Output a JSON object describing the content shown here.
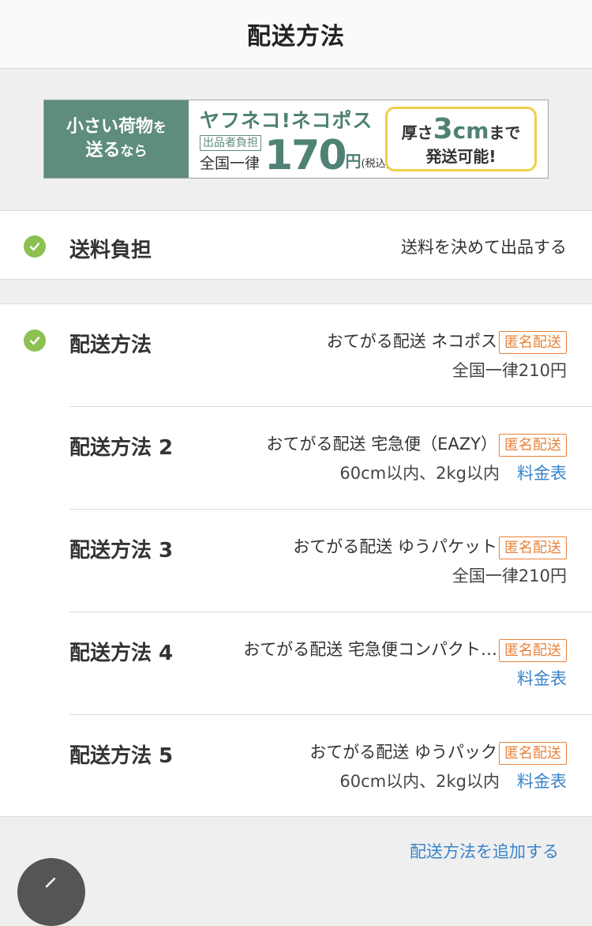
{
  "header": {
    "title": "配送方法"
  },
  "banner": {
    "left_line1": "小さい荷物",
    "left_line1_suffix": "を",
    "left_line2": "送る",
    "left_line2_suffix": "なら",
    "brand": "ヤフネコ!ネコポス",
    "tag": "出品者負担",
    "uniform": "全国一律",
    "price": "170",
    "yen": "円",
    "tax": "(税込)",
    "right_prefix": "厚さ",
    "right_number": "3",
    "right_unit": "cm",
    "right_suffix": "まで",
    "right_line2": "発送可能!"
  },
  "shipping_fee": {
    "label": "送料負担",
    "value": "送料を決めて出品する"
  },
  "methods": [
    {
      "label": "配送方法",
      "service": "おてがる配送 ネコポス",
      "badge": "匿名配送",
      "sub": "全国一律210円",
      "link": ""
    },
    {
      "label": "配送方法 2",
      "service": "おてがる配送 宅急便（EAZY）",
      "badge": "匿名配送",
      "sub": "60cm以内、2kg以内",
      "link": "料金表"
    },
    {
      "label": "配送方法 3",
      "service": "おてがる配送 ゆうパケット",
      "badge": "匿名配送",
      "sub": "全国一律210円",
      "link": ""
    },
    {
      "label": "配送方法 4",
      "service": "おてがる配送 宅急便コンパクト…",
      "badge": "匿名配送",
      "sub": "",
      "link": "料金表"
    },
    {
      "label": "配送方法 5",
      "service": "おてがる配送 ゆうパック",
      "badge": "匿名配送",
      "sub": "60cm以内、2kg以内",
      "link": "料金表"
    }
  ],
  "add_method": "配送方法を追加する",
  "colors": {
    "check": "#8cc152",
    "badge": "#e8823a",
    "link": "#3a84c9",
    "banner_green": "#5e8c7f"
  }
}
